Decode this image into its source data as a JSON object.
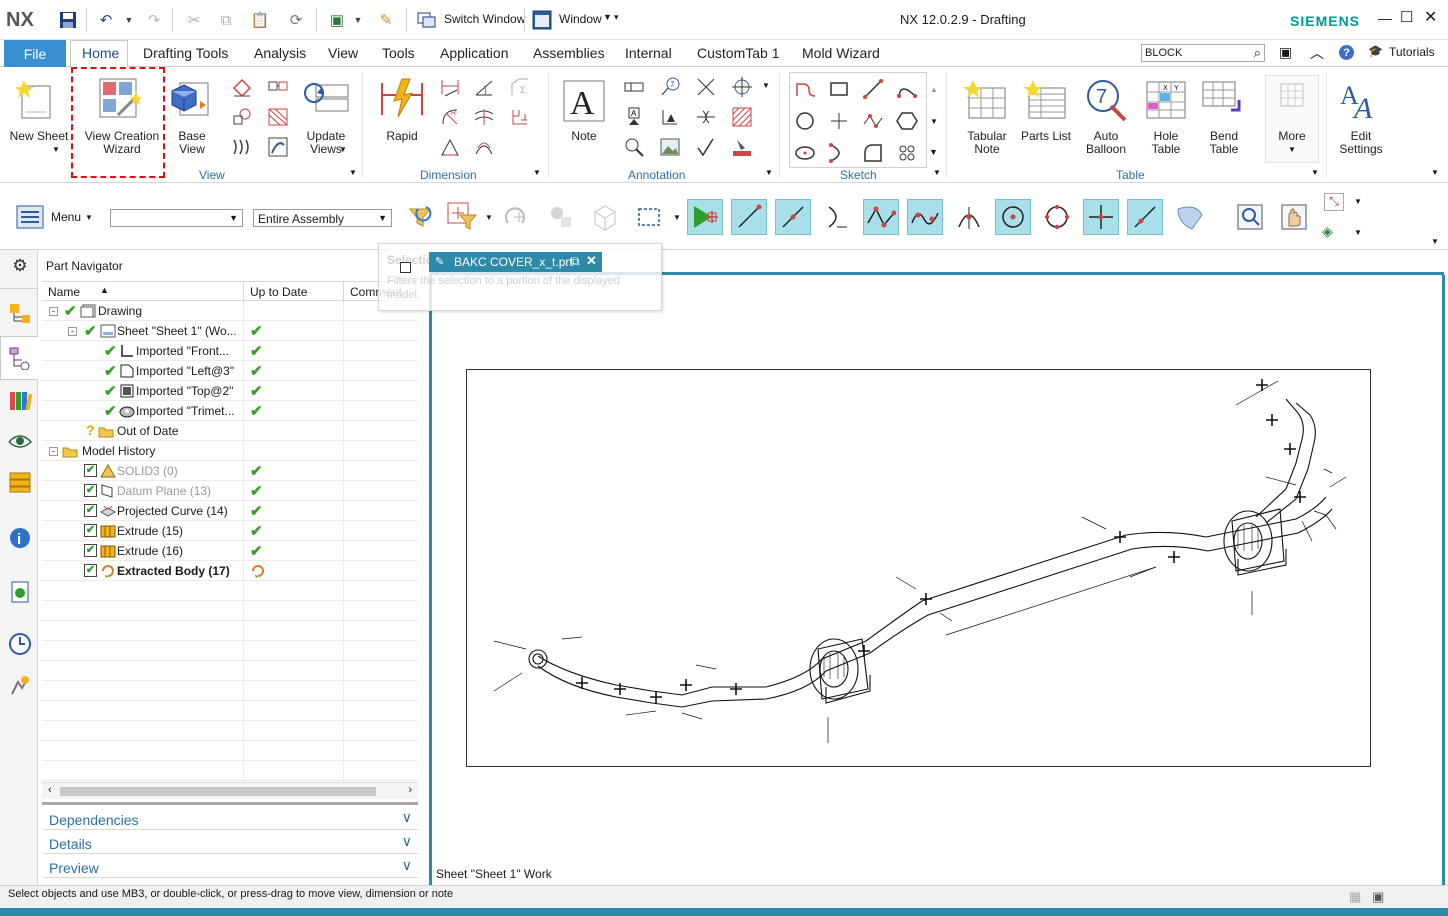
{
  "app": {
    "logo": "NX",
    "title": "NX 12.0.2.9 - Drafting",
    "brand": "SIEMENS",
    "brand_color": "#009999",
    "accent": "#2f6fa8",
    "file_tab_color": "#3a8fd1"
  },
  "quick_access": {
    "switch_window": "Switch Window",
    "window": "Window"
  },
  "tabs": [
    {
      "label": "File"
    },
    {
      "label": "Home"
    },
    {
      "label": "Drafting Tools"
    },
    {
      "label": "Analysis"
    },
    {
      "label": "View"
    },
    {
      "label": "Tools"
    },
    {
      "label": "Application"
    },
    {
      "label": "Assemblies"
    },
    {
      "label": "Internal"
    },
    {
      "label": "CustomTab 1"
    },
    {
      "label": "Mold Wizard"
    }
  ],
  "search": {
    "value": "BLOCK"
  },
  "tutorials": "Tutorials",
  "ribbon": {
    "new_sheet": "New Sheet",
    "view_creation_wizard": "View Creation Wizard",
    "base_view": "Base View",
    "update_views": "Update Views",
    "rapid": "Rapid",
    "note": "Note",
    "tabular_note": "Tabular Note",
    "parts_list": "Parts List",
    "auto_balloon": "Auto Balloon",
    "hole_table": "Hole Table",
    "bend_table": "Bend Table",
    "more": "More",
    "edit_settings": "Edit Settings",
    "groups": {
      "view": "View",
      "dimension": "Dimension",
      "annotation": "Annotation",
      "sketch": "Sketch",
      "table": "Table"
    }
  },
  "toolbar": {
    "menu": "Menu",
    "filter_value": "",
    "scope_value": "Entire Assembly"
  },
  "tooltip": {
    "title": "Selection",
    "body": "Filters the selection to a portion of the displayed model."
  },
  "doc_tab": "BAKC COVER_x_t.prt",
  "navigator": {
    "title": "Part Navigator",
    "columns": [
      "Name",
      "Up to Date",
      "Comment"
    ],
    "rows": [
      {
        "label": "Drawing"
      },
      {
        "label": "Sheet \"Sheet 1\" (Wo..."
      },
      {
        "label": "Imported \"Front..."
      },
      {
        "label": "Imported \"Left@3\""
      },
      {
        "label": "Imported \"Top@2\""
      },
      {
        "label": "Imported \"Trimet..."
      },
      {
        "label": "Out of Date"
      },
      {
        "label": "Model History"
      },
      {
        "label": "SOLID3 (0)"
      },
      {
        "label": "Datum Plane (13)"
      },
      {
        "label": "Projected Curve (14)"
      },
      {
        "label": "Extrude (15)"
      },
      {
        "label": "Extrude (16)"
      },
      {
        "label": "Extracted Body (17)"
      }
    ],
    "panels": [
      "Dependencies",
      "Details",
      "Preview"
    ]
  },
  "sheet_label": "Sheet \"Sheet 1\" Work",
  "status": "Select objects and use MB3, or double-click, or press-drag to move view, dimension or note"
}
